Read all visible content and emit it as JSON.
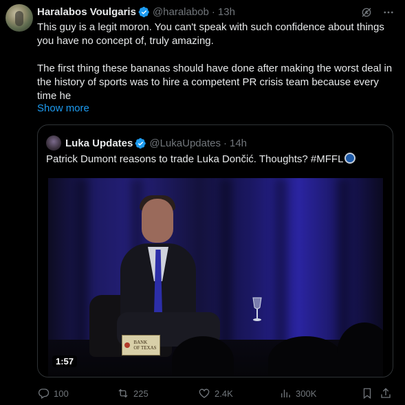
{
  "tweet": {
    "author_name": "Haralabos Voulgaris",
    "handle": "@haralabob",
    "separator": "·",
    "time": "13h",
    "paragraph_1": "This guy is a legit moron. You can't speak with such confidence about things you have no concept of, truly amazing.",
    "paragraph_2": "The first thing these bananas should have done after making the worst deal in the history of sports was to hire a competent PR crisis team because every time he",
    "show_more": "Show more"
  },
  "quote": {
    "author_name": "Luka Updates",
    "handle": "@LukaUpdates",
    "separator": "·",
    "time": "14h",
    "text": "Patrick Dumont reasons to trade Luka Dončić. Thoughts? #MFFL",
    "video_duration": "1:57",
    "sign_text_1": "BANK",
    "sign_text_2": "OF TEXAS"
  },
  "actions": {
    "replies": "100",
    "reposts": "225",
    "likes": "2.4K",
    "views": "300K"
  },
  "icons": {
    "verified": "verified-badge-icon",
    "grok": "grok-icon",
    "more": "more-icon",
    "reply": "reply-icon",
    "repost": "repost-icon",
    "like": "like-icon",
    "views": "views-icon",
    "bookmark": "bookmark-icon",
    "share": "share-icon"
  },
  "colors": {
    "background": "#000000",
    "text": "#e7e9ea",
    "muted": "#71767b",
    "link": "#1d9bf0",
    "border": "#2f3336"
  }
}
